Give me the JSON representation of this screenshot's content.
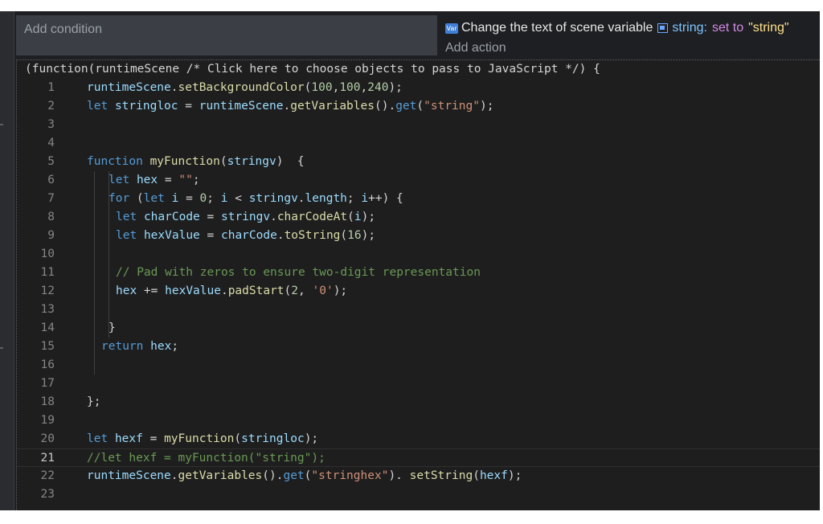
{
  "event": {
    "condition_placeholder": "Add condition",
    "action": {
      "icon": "variable-icon",
      "icon_text": "Var",
      "description": "Change the text of scene variable",
      "variable_icon": "scene-variable-icon",
      "variable_name": "string:",
      "operator": "set to",
      "value": "\"string\""
    },
    "add_action_label": "Add action"
  },
  "code": {
    "header": "(function(runtimeScene /* Click here to choose objects to pass to JavaScript */) {",
    "current_line": 21,
    "lines": [
      {
        "n": "1",
        "indent": 0,
        "tokens": [
          [
            "var",
            "runtimeScene"
          ],
          [
            "",
            "."
          ],
          [
            "fn",
            "setBackgroundColor"
          ],
          [
            "",
            "("
          ],
          [
            "num",
            "100"
          ],
          [
            "",
            ","
          ],
          [
            "num",
            "100"
          ],
          [
            "",
            ","
          ],
          [
            "num",
            "240"
          ],
          [
            "",
            ");"
          ]
        ]
      },
      {
        "n": "2",
        "indent": 0,
        "tokens": [
          [
            "kw",
            "let"
          ],
          [
            "",
            " "
          ],
          [
            "var",
            "stringloc"
          ],
          [
            "",
            " = "
          ],
          [
            "var",
            "runtimeScene"
          ],
          [
            "",
            "."
          ],
          [
            "fn",
            "getVariables"
          ],
          [
            "",
            "()."
          ],
          [
            "kw",
            "get"
          ],
          [
            "",
            "("
          ],
          [
            "str",
            "\"string\""
          ],
          [
            "",
            ");"
          ]
        ]
      },
      {
        "n": "3",
        "indent": 0,
        "tokens": []
      },
      {
        "n": "4",
        "indent": 0,
        "tokens": []
      },
      {
        "n": "5",
        "indent": 0,
        "tokens": [
          [
            "kw",
            "function"
          ],
          [
            "",
            " "
          ],
          [
            "fn",
            "myFunction"
          ],
          [
            "",
            "("
          ],
          [
            "var",
            "stringv"
          ],
          [
            "",
            ")  {"
          ]
        ]
      },
      {
        "n": "6",
        "indent": 3,
        "tokens": [
          [
            "kw",
            "let"
          ],
          [
            "",
            " "
          ],
          [
            "var",
            "hex"
          ],
          [
            "",
            " = "
          ],
          [
            "str",
            "\"\""
          ],
          [
            "",
            ";"
          ]
        ]
      },
      {
        "n": "7",
        "indent": 3,
        "tokens": [
          [
            "kw",
            "for"
          ],
          [
            "",
            " ("
          ],
          [
            "kw",
            "let"
          ],
          [
            "",
            " "
          ],
          [
            "var",
            "i"
          ],
          [
            "",
            " = "
          ],
          [
            "num",
            "0"
          ],
          [
            "",
            "; "
          ],
          [
            "var",
            "i"
          ],
          [
            "",
            " < "
          ],
          [
            "var",
            "stringv"
          ],
          [
            "",
            "."
          ],
          [
            "var",
            "length"
          ],
          [
            "",
            "; "
          ],
          [
            "var",
            "i"
          ],
          [
            "",
            "++) {"
          ]
        ]
      },
      {
        "n": "8",
        "indent": 4,
        "tokens": [
          [
            "kw",
            "let"
          ],
          [
            "",
            " "
          ],
          [
            "var",
            "charCode"
          ],
          [
            "",
            " = "
          ],
          [
            "var",
            "stringv"
          ],
          [
            "",
            "."
          ],
          [
            "fn",
            "charCodeAt"
          ],
          [
            "",
            "("
          ],
          [
            "var",
            "i"
          ],
          [
            "",
            ");"
          ]
        ]
      },
      {
        "n": "9",
        "indent": 4,
        "tokens": [
          [
            "kw",
            "let"
          ],
          [
            "",
            " "
          ],
          [
            "var",
            "hexValue"
          ],
          [
            "",
            " = "
          ],
          [
            "var",
            "charCode"
          ],
          [
            "",
            "."
          ],
          [
            "fn",
            "toString"
          ],
          [
            "",
            "("
          ],
          [
            "num",
            "16"
          ],
          [
            "",
            ");"
          ]
        ]
      },
      {
        "n": "10",
        "indent": 0,
        "tokens": []
      },
      {
        "n": "11",
        "indent": 4,
        "tokens": [
          [
            "cm",
            "// Pad with zeros to ensure two-digit representation"
          ]
        ]
      },
      {
        "n": "12",
        "indent": 4,
        "tokens": [
          [
            "var",
            "hex"
          ],
          [
            "",
            " += "
          ],
          [
            "var",
            "hexValue"
          ],
          [
            "",
            "."
          ],
          [
            "fn",
            "padStart"
          ],
          [
            "",
            "("
          ],
          [
            "num",
            "2"
          ],
          [
            "",
            ", "
          ],
          [
            "str",
            "'0'"
          ],
          [
            "",
            ");"
          ]
        ]
      },
      {
        "n": "13",
        "indent": 0,
        "tokens": []
      },
      {
        "n": "14",
        "indent": 3,
        "tokens": [
          [
            "",
            "}"
          ]
        ]
      },
      {
        "n": "15",
        "indent": 2,
        "tokens": [
          [
            "kw",
            "return"
          ],
          [
            "",
            " "
          ],
          [
            "var",
            "hex"
          ],
          [
            "",
            ";"
          ]
        ]
      },
      {
        "n": "16",
        "indent": 0,
        "tokens": []
      },
      {
        "n": "17",
        "indent": 0,
        "tokens": []
      },
      {
        "n": "18",
        "indent": 0,
        "tokens": [
          [
            "",
            "};"
          ]
        ]
      },
      {
        "n": "19",
        "indent": 0,
        "tokens": []
      },
      {
        "n": "20",
        "indent": 0,
        "tokens": [
          [
            "kw",
            "let"
          ],
          [
            "",
            " "
          ],
          [
            "var",
            "hexf"
          ],
          [
            "",
            " = "
          ],
          [
            "fn",
            "myFunction"
          ],
          [
            "",
            "("
          ],
          [
            "var",
            "stringloc"
          ],
          [
            "",
            ");"
          ]
        ]
      },
      {
        "n": "21",
        "indent": 0,
        "tokens": [
          [
            "cm",
            "//let hexf = myFunction(\"string\");"
          ]
        ]
      },
      {
        "n": "22",
        "indent": 0,
        "tokens": [
          [
            "var",
            "runtimeScene"
          ],
          [
            "",
            "."
          ],
          [
            "fn",
            "getVariables"
          ],
          [
            "",
            "()."
          ],
          [
            "kw",
            "get"
          ],
          [
            "",
            "("
          ],
          [
            "str",
            "\"stringhex\""
          ],
          [
            "",
            "). "
          ],
          [
            "fn",
            "setString"
          ],
          [
            "",
            "("
          ],
          [
            "var",
            "hexf"
          ],
          [
            "",
            ");"
          ]
        ]
      },
      {
        "n": "23",
        "indent": 0,
        "tokens": []
      }
    ]
  }
}
